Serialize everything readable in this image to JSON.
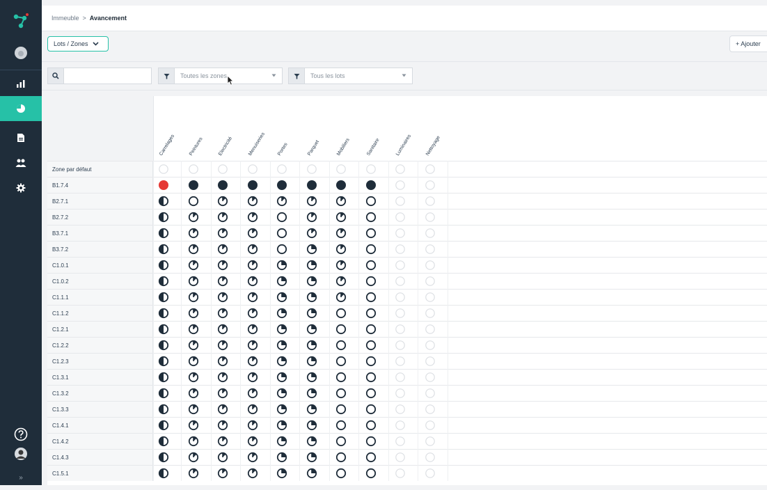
{
  "breadcrumb": {
    "root": "Immeuble",
    "separator": ">",
    "current": "Avancement"
  },
  "toolbar": {
    "view_select": "Lots / Zones",
    "add_button": "+ Ajouter"
  },
  "filters": {
    "search_value": "",
    "zones_select": "Toutes les zones",
    "lots_select": "Tous les lots"
  },
  "colors": {
    "accent": "#26c1a7",
    "sidebar": "#1f2d3a",
    "alert": "#e53935",
    "dark": "#1f2d3a"
  },
  "sidebar": {
    "items": [
      {
        "icon": "logo-icon"
      },
      {
        "icon": "project-avatar-icon"
      },
      {
        "icon": "bar-chart-icon"
      },
      {
        "icon": "progress-pie-icon",
        "active": true
      },
      {
        "icon": "document-icon"
      },
      {
        "icon": "users-icon"
      },
      {
        "icon": "gear-icon"
      },
      {
        "icon": "help-icon"
      },
      {
        "icon": "user-avatar-icon"
      },
      {
        "icon": "expand-icon",
        "label": "»"
      }
    ]
  },
  "grid": {
    "columns": [
      "Carrelages",
      "Peintures",
      "Electricité",
      "Menuiseries",
      "Portes",
      "Parquet",
      "Mobiliers",
      "Sanitaire",
      "Luminaires",
      "Nettoyage"
    ],
    "rows": [
      {
        "label": "Zone par défaut",
        "states": [
          -1,
          -1,
          -1,
          -1,
          -1,
          -1,
          -1,
          -1,
          -1,
          -1
        ]
      },
      {
        "label": "B1.7.4",
        "states": [
          5,
          4,
          4,
          4,
          4,
          4,
          4,
          4,
          -1,
          -1
        ]
      },
      {
        "label": "B2.7.1",
        "states": [
          2,
          0,
          1,
          1,
          1,
          1,
          1,
          0,
          -1,
          -1
        ]
      },
      {
        "label": "B2.7.2",
        "states": [
          2,
          1,
          1,
          1,
          0,
          1,
          1,
          0,
          -1,
          -1
        ]
      },
      {
        "label": "B3.7.1",
        "states": [
          2,
          1,
          1,
          1,
          0,
          1,
          1,
          0,
          -1,
          -1
        ]
      },
      {
        "label": "B3.7.2",
        "states": [
          2,
          1,
          1,
          1,
          0,
          3,
          1,
          0,
          -1,
          -1
        ]
      },
      {
        "label": "C1.0.1",
        "states": [
          2,
          1,
          1,
          1,
          3,
          3,
          1,
          0,
          -1,
          -1
        ]
      },
      {
        "label": "C1.0.2",
        "states": [
          2,
          1,
          1,
          1,
          3,
          3,
          1,
          0,
          -1,
          -1
        ]
      },
      {
        "label": "C1.1.1",
        "states": [
          2,
          1,
          1,
          1,
          3,
          3,
          1,
          0,
          -1,
          -1
        ]
      },
      {
        "label": "C1.1.2",
        "states": [
          2,
          1,
          1,
          1,
          3,
          3,
          0,
          0,
          -1,
          -1
        ]
      },
      {
        "label": "C1.2.1",
        "states": [
          2,
          1,
          1,
          1,
          3,
          3,
          0,
          0,
          -1,
          -1
        ]
      },
      {
        "label": "C1.2.2",
        "states": [
          2,
          1,
          1,
          1,
          3,
          3,
          0,
          0,
          -1,
          -1
        ]
      },
      {
        "label": "C1.2.3",
        "states": [
          2,
          1,
          1,
          1,
          3,
          3,
          0,
          0,
          -1,
          -1
        ]
      },
      {
        "label": "C1.3.1",
        "states": [
          2,
          1,
          1,
          1,
          3,
          3,
          0,
          0,
          -1,
          -1
        ]
      },
      {
        "label": "C1.3.2",
        "states": [
          2,
          1,
          1,
          1,
          3,
          3,
          0,
          0,
          -1,
          -1
        ]
      },
      {
        "label": "C1.3.3",
        "states": [
          2,
          1,
          1,
          1,
          3,
          3,
          0,
          0,
          -1,
          -1
        ]
      },
      {
        "label": "C1.4.1",
        "states": [
          2,
          1,
          1,
          1,
          3,
          3,
          0,
          0,
          -1,
          -1
        ]
      },
      {
        "label": "C1.4.2",
        "states": [
          2,
          1,
          1,
          1,
          3,
          3,
          0,
          0,
          -1,
          -1
        ]
      },
      {
        "label": "C1.4.3",
        "states": [
          2,
          1,
          1,
          1,
          3,
          3,
          0,
          0,
          -1,
          -1
        ]
      },
      {
        "label": "C1.5.1",
        "states": [
          2,
          1,
          1,
          1,
          3,
          3,
          0,
          0,
          -1,
          -1
        ]
      }
    ]
  }
}
